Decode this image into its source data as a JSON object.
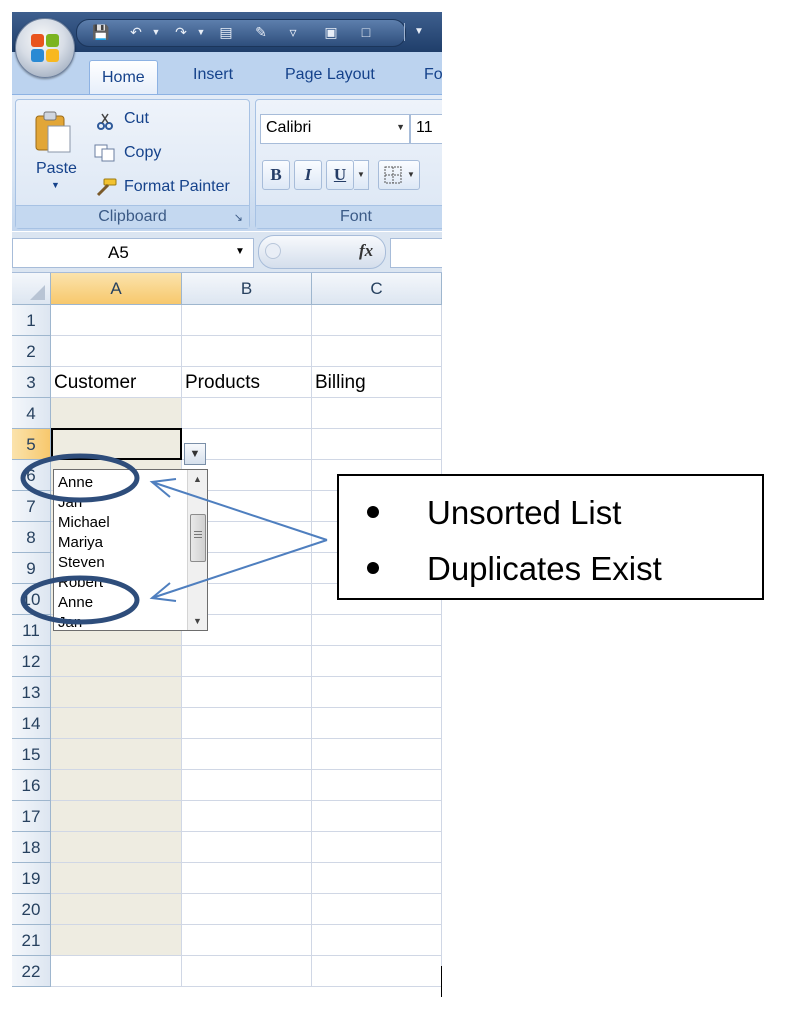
{
  "tabs": [
    {
      "label": "Home",
      "active": true
    },
    {
      "label": "Insert",
      "active": false
    },
    {
      "label": "Page Layout",
      "active": false
    },
    {
      "label": "Fo",
      "active": false
    }
  ],
  "clipboard": {
    "paste_label": "Paste",
    "cut_label": "Cut",
    "copy_label": "Copy",
    "format_painter_label": "Format Painter",
    "group_label": "Clipboard"
  },
  "font": {
    "name": "Calibri",
    "size": "11",
    "bold": "B",
    "italic": "I",
    "underline": "U",
    "group_label": "Font"
  },
  "formula_bar": {
    "name_box": "A5",
    "fx": "fx"
  },
  "columns": [
    "A",
    "B",
    "C"
  ],
  "rows": [
    "1",
    "2",
    "3",
    "4",
    "5",
    "6",
    "7",
    "8",
    "9",
    "10",
    "11",
    "12",
    "13",
    "14",
    "15",
    "16",
    "17",
    "18",
    "19",
    "20",
    "21",
    "22"
  ],
  "cells": {
    "A3": "Customer",
    "B3": "Products",
    "C3": "Billing"
  },
  "dropdown_items": [
    "Anne",
    "Jan",
    "Michael",
    "Mariya",
    "Steven",
    "Robert",
    "Anne",
    "Jan"
  ],
  "callout": {
    "items": [
      "Unsorted List",
      "Duplicates Exist"
    ]
  },
  "colors": {
    "ribbon_text": "#15428b",
    "selected_header": "#f7c86d",
    "shaded_cell": "#eeece1",
    "annotation_blue": "#2e4d7b",
    "arrow_blue": "#4f7fbf"
  }
}
